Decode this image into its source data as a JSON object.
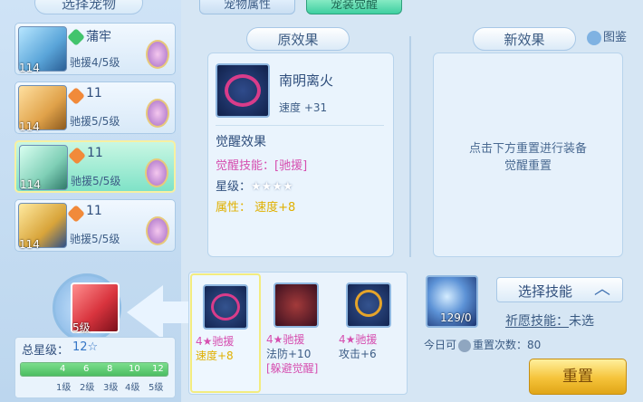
{
  "left_panel": {
    "title": "选择宠物",
    "pets": [
      {
        "name": "蒲牢",
        "level": "114",
        "desc": "驰援4/5级"
      },
      {
        "name": "11",
        "level": "114",
        "desc": "驰援5/5级"
      },
      {
        "name": "11",
        "level": "114",
        "desc": "驰援5/5级"
      },
      {
        "name": "11",
        "level": "114",
        "desc": "驰援5/5级"
      }
    ],
    "selected_index": 2,
    "skill_level": "5级",
    "total_stars_label": "总星级：",
    "total_stars_value": "12",
    "star_glyph": "☆",
    "progress_ticks": [
      "4",
      "6",
      "8",
      "10",
      "12"
    ],
    "progress_levels": [
      "1级",
      "2级",
      "3级",
      "4级",
      "5级"
    ],
    "progress_fraction": 1.0
  },
  "tabs": {
    "pet_attr": "宠物属性",
    "awaken": "宠装觉醒"
  },
  "original": {
    "title": "原效果",
    "item_name": "南明离火",
    "item_stat": "速度 +31",
    "awaken_title": "觉醒效果",
    "awaken_skill": "觉醒技能：[驰援]",
    "star_label": "星级：",
    "stars": "★★★★",
    "attr": "属性：  速度+8"
  },
  "new_effect": {
    "title": "新效果",
    "hint_line1": "点击下方重置进行装备",
    "hint_line2": "觉醒重置"
  },
  "picture_label": "图鉴",
  "slots": [
    {
      "l1": "4★驰援",
      "l2": "速度+8",
      "l3": ""
    },
    {
      "l1": "4★驰援",
      "l2": "法防+10",
      "l3": "[躲避觉醒]"
    },
    {
      "l1": "4★驰援",
      "l2": "攻击+6",
      "l3": ""
    }
  ],
  "orb_count": "129/0",
  "select_skill": "选择技能",
  "wish_label": "祈愿技能",
  "wish_value": "：未选",
  "today_prefix": "今日可",
  "today_suffix": "重置次数：80",
  "reset_button": "重置",
  "colors": {
    "selected_card": "#7fe2c7",
    "pink_text": "#d64fb0",
    "gold_button": "#f5c33a"
  }
}
